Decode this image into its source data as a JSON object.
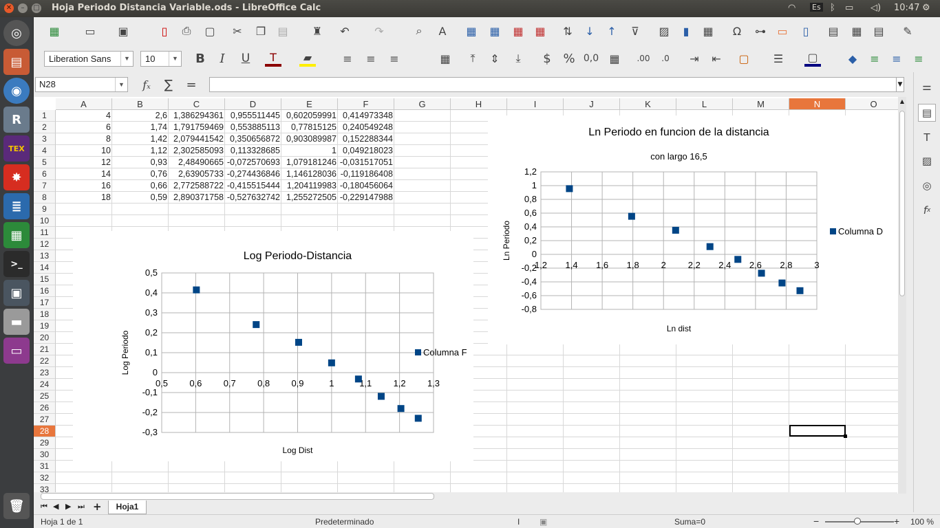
{
  "window": {
    "title": "Hoja Periodo Distancia Variable.ods - LibreOffice Calc",
    "clock": "10:47",
    "keyboard": "Es"
  },
  "font": {
    "name": "Liberation Sans",
    "size": "10"
  },
  "formula": {
    "cell_ref": "N28",
    "fx": "fₓ",
    "sum": "∑",
    "eq": "=",
    "content": ""
  },
  "columns": [
    "A",
    "B",
    "C",
    "D",
    "E",
    "F",
    "G",
    "H",
    "I",
    "J",
    "K",
    "L",
    "M",
    "N",
    "O"
  ],
  "selected_col": "N",
  "selected_row": "28",
  "rows": [
    "1",
    "2",
    "3",
    "4",
    "5",
    "6",
    "7",
    "8",
    "9",
    "10",
    "11",
    "12",
    "13",
    "14",
    "15",
    "16",
    "17",
    "18",
    "19",
    "20",
    "21",
    "22",
    "23",
    "24",
    "25",
    "26",
    "27",
    "28",
    "29",
    "30",
    "31",
    "32",
    "33"
  ],
  "table": [
    [
      "4",
      "2,6",
      "1,386294361",
      "0,955511445",
      "0,602059991",
      "0,414973348"
    ],
    [
      "6",
      "1,74",
      "1,791759469",
      "0,553885113",
      "0,77815125",
      "0,240549248"
    ],
    [
      "8",
      "1,42",
      "2,079441542",
      "0,350656872",
      "0,903089987",
      "0,152288344"
    ],
    [
      "10",
      "1,12",
      "2,302585093",
      "0,113328685",
      "1",
      "0,049218023"
    ],
    [
      "12",
      "0,93",
      "2,48490665",
      "-0,072570693",
      "1,079181246",
      "-0,031517051"
    ],
    [
      "14",
      "0,76",
      "2,63905733",
      "-0,274436846",
      "1,146128036",
      "-0,119186408"
    ],
    [
      "16",
      "0,66",
      "2,772588722",
      "-0,415515444",
      "1,204119983",
      "-0,180456064"
    ],
    [
      "18",
      "0,59",
      "2,890371758",
      "-0,527632742",
      "1,255272505",
      "-0,229147988"
    ]
  ],
  "chart_data": [
    {
      "type": "scatter",
      "title": "Log Periodo-Distancia",
      "xlabel": "Log Dist",
      "ylabel": "Log Periodo",
      "xlim": [
        0.5,
        1.3
      ],
      "ylim": [
        -0.3,
        0.5
      ],
      "xticks": [
        "0,5",
        "0,6",
        "0,7",
        "0,8",
        "0,9",
        "1",
        "1,1",
        "1,2",
        "1,3"
      ],
      "yticks": [
        "0,5",
        "0,4",
        "0,3",
        "0,2",
        "0,1",
        "0",
        "-0,1",
        "-0,2",
        "-0,3"
      ],
      "grid": true,
      "legend": "right",
      "color": "#004586",
      "series": [
        {
          "name": "Columna F",
          "x": [
            0.602,
            0.778,
            0.903,
            1.0,
            1.079,
            1.146,
            1.204,
            1.255
          ],
          "y": [
            0.415,
            0.241,
            0.152,
            0.049,
            -0.032,
            -0.119,
            -0.18,
            -0.229
          ]
        }
      ]
    },
    {
      "type": "scatter",
      "title": "Ln Periodo en funcion de la distancia",
      "subtitle": "con largo 16,5",
      "xlabel": "Ln dist",
      "ylabel": "Ln Periodo",
      "xlim": [
        1.2,
        3.0
      ],
      "ylim": [
        -0.8,
        1.2
      ],
      "xticks": [
        "1,2",
        "1,4",
        "1,6",
        "1,8",
        "2",
        "2,2",
        "2,4",
        "2,6",
        "2,8",
        "3"
      ],
      "yticks": [
        "1,2",
        "1",
        "0,8",
        "0,6",
        "0,4",
        "0,2",
        "0",
        "-0,2",
        "-0,4",
        "-0,6",
        "-0,8"
      ],
      "grid": true,
      "legend": "right",
      "color": "#004586",
      "series": [
        {
          "name": "Columna D",
          "x": [
            1.386,
            1.792,
            2.079,
            2.303,
            2.485,
            2.639,
            2.773,
            2.89
          ],
          "y": [
            0.956,
            0.554,
            0.351,
            0.113,
            -0.073,
            -0.274,
            -0.416,
            -0.528
          ]
        }
      ]
    }
  ],
  "sheet": {
    "tab": "Hoja1"
  },
  "status": {
    "sheet_info": "Hoja 1 de 1",
    "style": "Predeterminado",
    "sum": "Suma=0",
    "zoom": "100 %"
  }
}
